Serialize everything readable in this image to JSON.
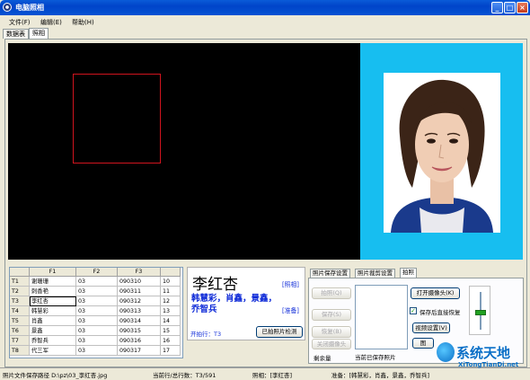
{
  "window": {
    "title": "电脑照相"
  },
  "menu": [
    {
      "label": "文件(F)"
    },
    {
      "label": "编辑(E)"
    },
    {
      "label": "帮助(H)"
    }
  ],
  "tabs": [
    {
      "label": "数据表"
    },
    {
      "label": "照相"
    }
  ],
  "grid": {
    "columns": [
      "",
      "F1",
      "F2",
      "F3",
      ""
    ],
    "rows": [
      [
        "T1",
        "谢珊珊",
        "03",
        "090310",
        "10"
      ],
      [
        "T2",
        "刺香艳",
        "03",
        "090311",
        "11"
      ],
      [
        "T3",
        "李红杏",
        "03",
        "090312",
        "12"
      ],
      [
        "T4",
        "韩慧彩",
        "03",
        "090313",
        "13"
      ],
      [
        "T5",
        "肖鑫",
        "03",
        "090314",
        "14"
      ],
      [
        "T6",
        "景鑫",
        "03",
        "090315",
        "15"
      ],
      [
        "T7",
        "乔智兵",
        "03",
        "090316",
        "16"
      ],
      [
        "T8",
        "代三军",
        "03",
        "090317",
        "17"
      ]
    ]
  },
  "info": {
    "name": "李红杏",
    "prepared": "韩慧彩，肖鑫，景鑫，乔智兵",
    "photo_tag": "[照相]",
    "prep_tag": "[准备]",
    "start_row": "开拍行：T3",
    "check_btn": "已拍照片检测"
  },
  "photo_tabs": [
    {
      "label": "照片保存设置"
    },
    {
      "label": "照片裁剪设置"
    },
    {
      "label": "拍照"
    }
  ],
  "capture": {
    "shoot_btn": "拍照(Q)",
    "save_btn": "保存(S)",
    "restore_btn": "恢复(B)",
    "close_camera_btn": "关闭摄像头",
    "remaining_label": "剩余量",
    "saved_label": "当前已保存照片",
    "open_camera_btn": "打开摄像头(K)",
    "auto_restore_label": "保存后直接恢复",
    "auto_restore_checked": true,
    "video_settings_btn": "视频设置(V)",
    "image_btn": "图"
  },
  "status": {
    "path": "照片文件保存路径 D:\\pz\\03_李红杏.jpg",
    "row": "当前行/总行数：T3/591",
    "photo": "照相：[李红杏]",
    "prep": "准备：[韩慧彩，肖鑫，景鑫，乔智兵]"
  },
  "watermark": {
    "title": "系统天地",
    "url": "XiTongTianDi.net"
  },
  "colors": {
    "camera_bg": "#000000",
    "photo_bg": "#17BEF0",
    "accent_blue": "#0F2BD8",
    "face_box": "#D0141E"
  }
}
